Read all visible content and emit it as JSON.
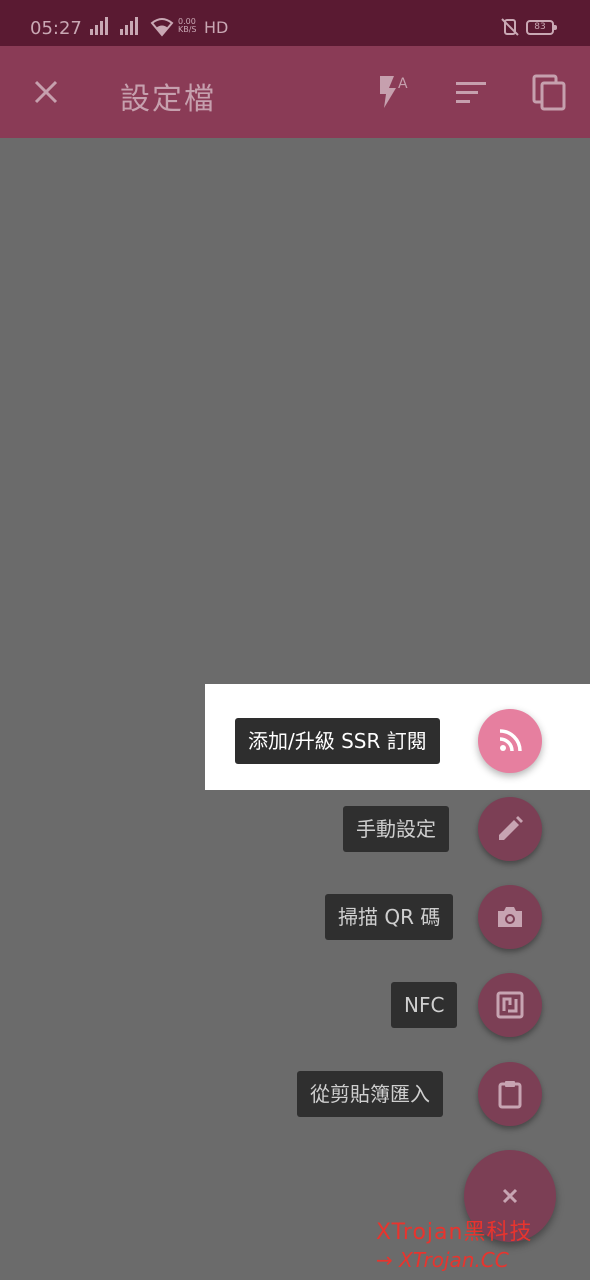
{
  "status_bar": {
    "time": "05:27",
    "signal1": "4G",
    "signal2": "4G",
    "net_speed": "0.00\nKB/S",
    "hd": "HD",
    "battery": "83"
  },
  "app_bar": {
    "title": "設定檔"
  },
  "menu": {
    "items": [
      {
        "label": "添加/升級 SSR 訂閱",
        "icon": "rss-icon",
        "active": true
      },
      {
        "label": "手動設定",
        "icon": "pencil-icon",
        "active": false
      },
      {
        "label": "掃描 QR 碼",
        "icon": "camera-icon",
        "active": false
      },
      {
        "label": "NFC",
        "icon": "nfc-icon",
        "active": false
      },
      {
        "label": "從剪貼簿匯入",
        "icon": "clipboard-icon",
        "active": false
      }
    ]
  },
  "watermark": {
    "line1": "XTrojan黑科技",
    "line2": "→ XTrojan.CC"
  },
  "colors": {
    "status_bar": "#5a1a32",
    "app_bar": "#8a3b56",
    "overlay": "#6b6b6b",
    "fab": "#7c3f55",
    "fab_active": "#e67f9f",
    "watermark": "#e8342e"
  }
}
